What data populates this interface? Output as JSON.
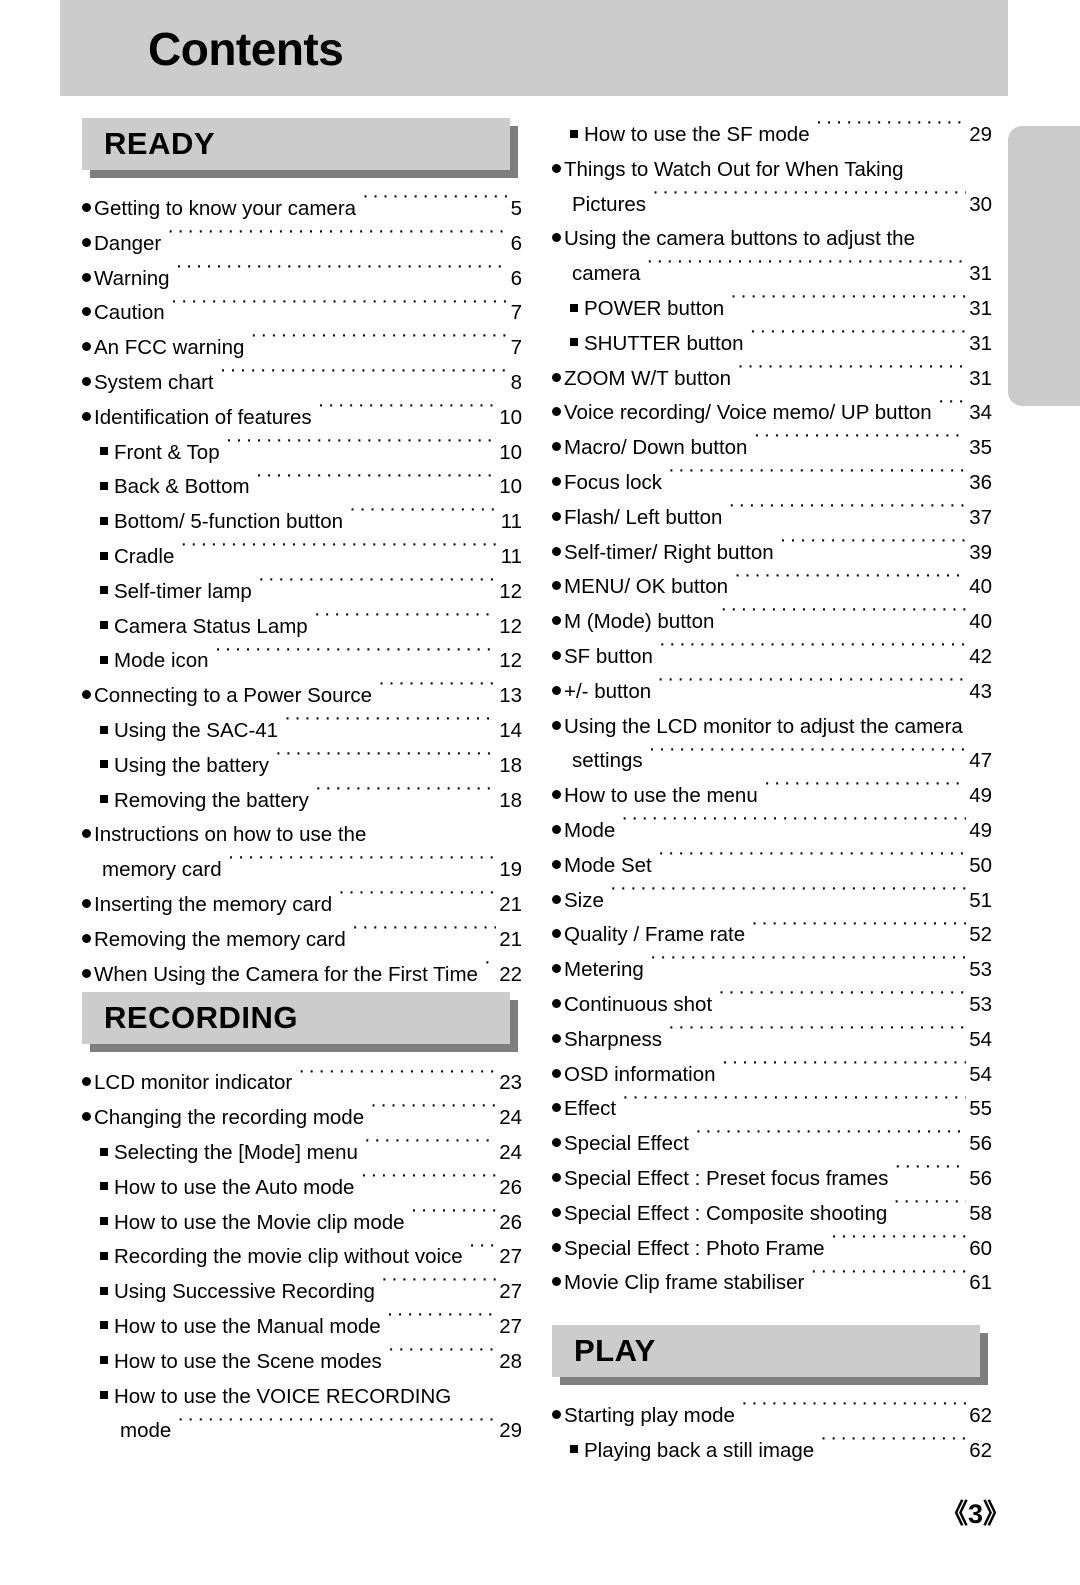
{
  "page": {
    "title": "Contents",
    "folio": "《3》"
  },
  "colors": {
    "banner_bg": "#cccccc",
    "section_bar_bg": "#cccccc",
    "section_bar_shadow": "#7e7e7e",
    "edge_tab": "#cbcbcb",
    "text": "#000000"
  },
  "left_column": {
    "sections": [
      {
        "heading": "READY",
        "entries": [
          {
            "level": 1,
            "bullet": "dot",
            "label": "Getting to know your camera",
            "page": "5"
          },
          {
            "level": 1,
            "bullet": "dot",
            "label": "Danger",
            "page": "6"
          },
          {
            "level": 1,
            "bullet": "dot",
            "label": "Warning",
            "page": "6"
          },
          {
            "level": 1,
            "bullet": "dot",
            "label": "Caution",
            "page": "7"
          },
          {
            "level": 1,
            "bullet": "dot",
            "label": "An FCC warning",
            "page": "7"
          },
          {
            "level": 1,
            "bullet": "dot",
            "label": "System chart",
            "page": "8"
          },
          {
            "level": 1,
            "bullet": "dot",
            "label": "Identification of features",
            "page": "10"
          },
          {
            "level": 2,
            "bullet": "square",
            "label": "Front & Top",
            "page": "10"
          },
          {
            "level": 2,
            "bullet": "square",
            "label": "Back & Bottom",
            "page": "10"
          },
          {
            "level": 2,
            "bullet": "square",
            "label": "Bottom/ 5-function button",
            "page": "11"
          },
          {
            "level": 2,
            "bullet": "square",
            "label": "Cradle",
            "page": "11"
          },
          {
            "level": 2,
            "bullet": "square",
            "label": "Self-timer lamp",
            "page": "12"
          },
          {
            "level": 2,
            "bullet": "square",
            "label": "Camera Status Lamp",
            "page": "12"
          },
          {
            "level": 2,
            "bullet": "square",
            "label": "Mode icon",
            "page": "12"
          },
          {
            "level": 1,
            "bullet": "dot",
            "label": "Connecting to a Power Source",
            "page": "13"
          },
          {
            "level": 2,
            "bullet": "square",
            "label": "Using the SAC-41",
            "page": "14"
          },
          {
            "level": 2,
            "bullet": "square",
            "label": "Using the battery",
            "page": "18"
          },
          {
            "level": 2,
            "bullet": "square",
            "label": "Removing the battery",
            "page": "18"
          },
          {
            "level": 1,
            "bullet": "dot",
            "label": "Instructions on how to use the",
            "page": "",
            "nolead": true
          },
          {
            "level": 1,
            "bullet": "none",
            "label": "memory card",
            "page": "19",
            "cont": true
          },
          {
            "level": 1,
            "bullet": "dot",
            "label": "Inserting the memory card",
            "page": "21"
          },
          {
            "level": 1,
            "bullet": "dot",
            "label": "Removing the memory card",
            "page": "21"
          },
          {
            "level": 1,
            "bullet": "dot",
            "label": "When Using the Camera for the First Time",
            "page": "22"
          }
        ]
      },
      {
        "heading": "RECORDING",
        "entries": [
          {
            "level": 1,
            "bullet": "dot",
            "label": "LCD monitor indicator",
            "page": "23"
          },
          {
            "level": 1,
            "bullet": "dot",
            "label": "Changing the recording mode",
            "page": "24"
          },
          {
            "level": 2,
            "bullet": "square",
            "label": "Selecting the [Mode] menu",
            "page": "24"
          },
          {
            "level": 2,
            "bullet": "square",
            "label": "How to use the Auto mode",
            "page": "26"
          },
          {
            "level": 2,
            "bullet": "square",
            "label": "How to use the Movie clip mode",
            "page": "26"
          },
          {
            "level": 2,
            "bullet": "square",
            "label": "Recording the movie clip without voice",
            "page": "27"
          },
          {
            "level": 2,
            "bullet": "square",
            "label": "Using Successive Recording",
            "page": "27"
          },
          {
            "level": 2,
            "bullet": "square",
            "label": "How to use the Manual mode",
            "page": "27"
          },
          {
            "level": 2,
            "bullet": "square",
            "label": "How to use the Scene modes",
            "page": "28"
          },
          {
            "level": 2,
            "bullet": "square",
            "label": "How to use the VOICE RECORDING",
            "page": "",
            "nolead": true
          },
          {
            "level": 2,
            "bullet": "none",
            "label": "mode",
            "page": "29",
            "cont": true
          }
        ]
      }
    ]
  },
  "right_column": {
    "lead_entries": [
      {
        "level": 2,
        "bullet": "square",
        "label": "How to use the SF mode",
        "page": "29"
      },
      {
        "level": 1,
        "bullet": "dot",
        "label": "Things to Watch Out for When Taking",
        "page": "",
        "nolead": true
      },
      {
        "level": 1,
        "bullet": "none",
        "label": "Pictures",
        "page": "30",
        "cont": true
      },
      {
        "level": 1,
        "bullet": "dot",
        "label": "Using the camera buttons to adjust the",
        "page": "",
        "nolead": true
      },
      {
        "level": 1,
        "bullet": "none",
        "label": "camera",
        "page": "31",
        "cont": true
      },
      {
        "level": 2,
        "bullet": "square",
        "label": "POWER button",
        "page": "31"
      },
      {
        "level": 2,
        "bullet": "square",
        "label": "SHUTTER button",
        "page": "31"
      },
      {
        "level": 1,
        "bullet": "dot",
        "label": "ZOOM W/T button",
        "page": "31"
      },
      {
        "level": 1,
        "bullet": "dot",
        "label": "Voice recording/ Voice memo/ UP button",
        "page": "34"
      },
      {
        "level": 1,
        "bullet": "dot",
        "label": "Macro/ Down button",
        "page": "35"
      },
      {
        "level": 1,
        "bullet": "dot",
        "label": "Focus lock",
        "page": "36"
      },
      {
        "level": 1,
        "bullet": "dot",
        "label": "Flash/ Left button",
        "page": "37"
      },
      {
        "level": 1,
        "bullet": "dot",
        "label": "Self-timer/ Right button",
        "page": "39"
      },
      {
        "level": 1,
        "bullet": "dot",
        "label": "MENU/ OK button",
        "page": "40"
      },
      {
        "level": 1,
        "bullet": "dot",
        "label": "M (Mode) button",
        "page": "40"
      },
      {
        "level": 1,
        "bullet": "dot",
        "label": "SF button",
        "page": "42"
      },
      {
        "level": 1,
        "bullet": "dot",
        "label": "+/- button",
        "page": "43"
      },
      {
        "level": 1,
        "bullet": "dot",
        "label": "Using the LCD monitor to adjust the camera",
        "page": "",
        "nolead": true
      },
      {
        "level": 1,
        "bullet": "none",
        "label": "settings",
        "page": "47",
        "cont": true
      },
      {
        "level": 1,
        "bullet": "dot",
        "label": "How to use the menu",
        "page": "49"
      },
      {
        "level": 1,
        "bullet": "dot",
        "label": "Mode",
        "page": "49"
      },
      {
        "level": 1,
        "bullet": "dot",
        "label": "Mode Set",
        "page": "50"
      },
      {
        "level": 1,
        "bullet": "dot",
        "label": "Size",
        "page": "51"
      },
      {
        "level": 1,
        "bullet": "dot",
        "label": "Quality / Frame rate",
        "page": "52"
      },
      {
        "level": 1,
        "bullet": "dot",
        "label": "Metering",
        "page": "53"
      },
      {
        "level": 1,
        "bullet": "dot",
        "label": "Continuous shot",
        "page": "53"
      },
      {
        "level": 1,
        "bullet": "dot",
        "label": "Sharpness",
        "page": "54"
      },
      {
        "level": 1,
        "bullet": "dot",
        "label": "OSD information",
        "page": "54"
      },
      {
        "level": 1,
        "bullet": "dot",
        "label": "Effect",
        "page": "55"
      },
      {
        "level": 1,
        "bullet": "dot",
        "label": "Special Effect",
        "page": "56"
      },
      {
        "level": 1,
        "bullet": "dot",
        "label": "Special Effect : Preset focus frames",
        "page": "56"
      },
      {
        "level": 1,
        "bullet": "dot",
        "label": "Special Effect : Composite shooting",
        "page": "58"
      },
      {
        "level": 1,
        "bullet": "dot",
        "label": "Special Effect : Photo Frame",
        "page": "60"
      },
      {
        "level": 1,
        "bullet": "dot",
        "label": "Movie Clip frame stabiliser",
        "page": "61"
      }
    ],
    "sections": [
      {
        "heading": "PLAY",
        "entries": [
          {
            "level": 1,
            "bullet": "dot",
            "label": "Starting play mode",
            "page": "62"
          },
          {
            "level": 2,
            "bullet": "square",
            "label": "Playing back a still image",
            "page": "62"
          }
        ]
      }
    ]
  }
}
